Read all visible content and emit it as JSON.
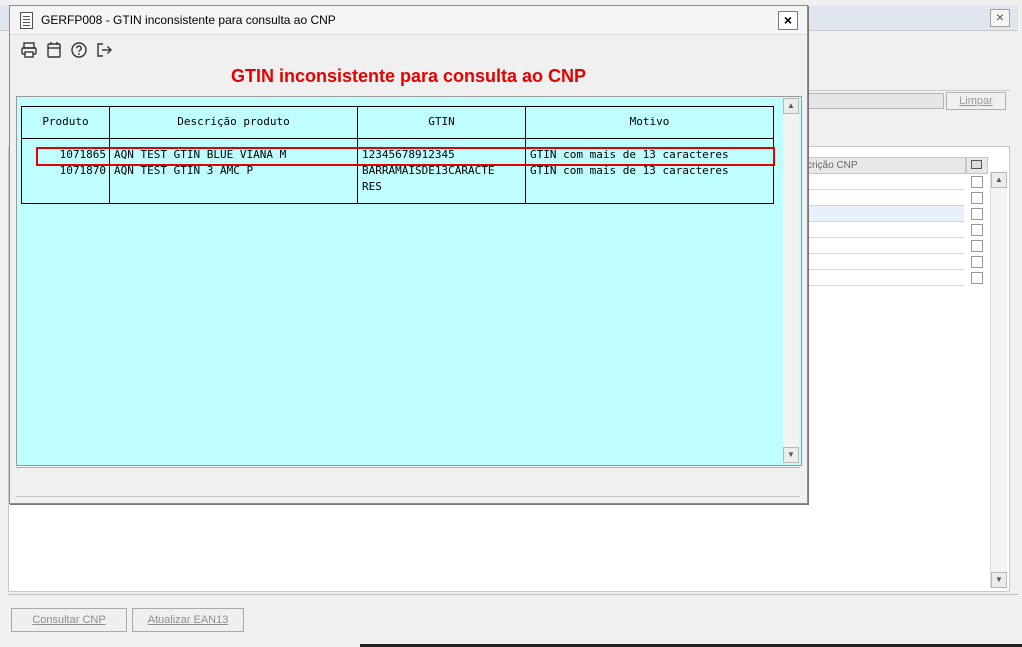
{
  "background_window": {
    "filter_button": "Limpar",
    "grid_header": "crição CNP",
    "bottom_buttons": [
      "Consultar CNP",
      "Atualizar EAN13"
    ]
  },
  "dialog": {
    "title": "GERFP008 - GTIN inconsistente para consulta ao CNP",
    "close_label": "×",
    "toolbar_icons": [
      "print-icon",
      "calendar-icon",
      "help-icon",
      "exit-icon"
    ],
    "heading": "GTIN inconsistente para consulta ao CNP",
    "heading_color": "#e60000",
    "content_bg": "#c0ffff",
    "table": {
      "headers": [
        "Produto",
        "Descrição produto",
        "GTIN",
        "Motivo"
      ],
      "rows": [
        {
          "produto": "1071865",
          "descricao": "AQN TEST GTIN BLUE VIANA M",
          "gtin": "12345678912345",
          "gtin_line2": "",
          "motivo": "GTIN com mais de 13 caracteres"
        },
        {
          "produto": "1071870",
          "descricao": "AQN TEST GTIN 3 AMC P",
          "gtin": "BARRAMAISDE13CARACTE",
          "gtin_line2": "RES",
          "motivo": "GTIN com mais de 13 caracteres"
        }
      ],
      "highlighted_row": 0,
      "highlight_color": "#e30000"
    }
  }
}
